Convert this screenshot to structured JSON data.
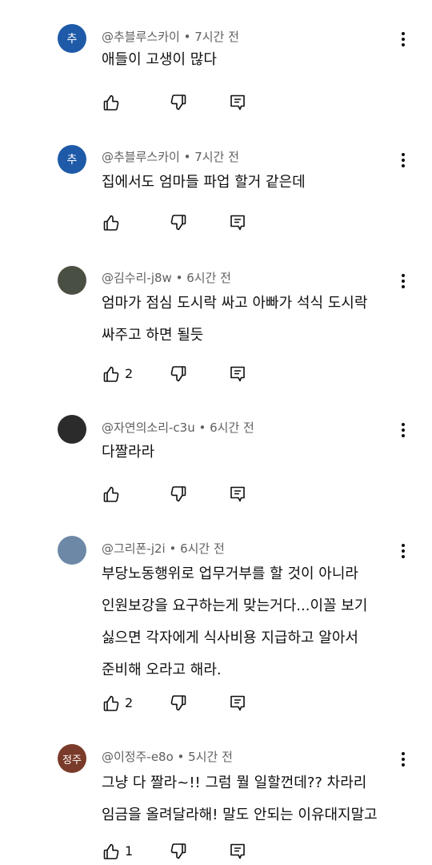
{
  "comments": [
    {
      "avatar": {
        "initial": "추",
        "color": "#1e5aa8"
      },
      "author": "@추블루스카이",
      "time": "7시간 전",
      "lines": [
        "애들이 고생이 많다"
      ],
      "likes": ""
    },
    {
      "avatar": {
        "initial": "추",
        "color": "#1e5aa8"
      },
      "author": "@추블루스카이",
      "time": "7시간 전",
      "lines": [
        "집에서도 엄마들 파업 할거 같은데"
      ],
      "likes": ""
    },
    {
      "avatar": {
        "initial": "",
        "color": "#4a4f44"
      },
      "author": "@김수리-j8w",
      "time": "6시간 전",
      "lines": [
        "엄마가 점심 도시락 싸고 아빠가 석식 도시락",
        "싸주고 하면 될듯"
      ],
      "likes": "2"
    },
    {
      "avatar": {
        "initial": "",
        "color": "#2b2b2b"
      },
      "author": "@자연의소리-c3u",
      "time": "6시간 전",
      "lines": [
        "다짤라라"
      ],
      "likes": ""
    },
    {
      "avatar": {
        "initial": "",
        "color": "#6d88a6"
      },
      "author": "@그리폰-j2i",
      "time": "6시간 전",
      "lines": [
        "부당노동행위로 업무거부를 할 것이 아니라",
        "인원보강을 요구하는게 맞는거다...이꼴 보기",
        "싫으면 각자에게 식사비용 지급하고 알아서",
        "준비해 오라고 해라."
      ],
      "likes": "2"
    },
    {
      "avatar": {
        "initial": "정주",
        "color": "#7a3b2a"
      },
      "author": "@이정주-e8o",
      "time": "5시간 전",
      "lines": [
        "그냥 다 짤라~!! 그럼 뭘 일할껀데?? 차라리",
        "임금을 올려달라해! 말도 안되는 이유대지말고"
      ],
      "likes": "1"
    }
  ]
}
